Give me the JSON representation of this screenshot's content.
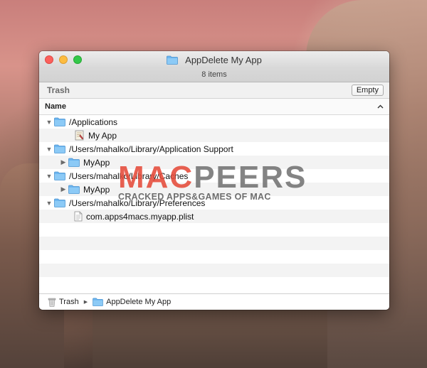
{
  "window": {
    "title": "AppDelete My App",
    "status": "8 items",
    "path_label": "Trash",
    "empty_button": "Empty",
    "column_header": "Name",
    "sort_indicator": "chevron-up-icon"
  },
  "rows": [
    {
      "label": "/Applications",
      "type": "folder",
      "expanded": true
    },
    {
      "label": "My App",
      "type": "app"
    },
    {
      "label": "/Users/mahalko/Library/Application Support",
      "type": "folder",
      "expanded": true
    },
    {
      "label": "MyApp",
      "type": "folder",
      "expanded": false
    },
    {
      "label": "/Users/mahalko/Library/Caches",
      "type": "folder",
      "expanded": true
    },
    {
      "label": "MyApp",
      "type": "folder",
      "expanded": false
    },
    {
      "label": "/Users/mahalko/Library/Preferences",
      "type": "folder",
      "expanded": true
    },
    {
      "label": "com.apps4macs.myapp.plist",
      "type": "file"
    }
  ],
  "watermark": {
    "brand_part1": "MAC",
    "brand_part2": "PEERS",
    "tagline": "CRACKED APPS&GAMES OF MAC"
  },
  "footer": {
    "crumb1": "Trash",
    "crumb2": "AppDelete My App"
  },
  "colors": {
    "folder": "#6cb6f0",
    "close": "#fc605c",
    "minimize": "#fdbc40",
    "zoom": "#34c84a",
    "watermark_red": "#e54b3a"
  }
}
